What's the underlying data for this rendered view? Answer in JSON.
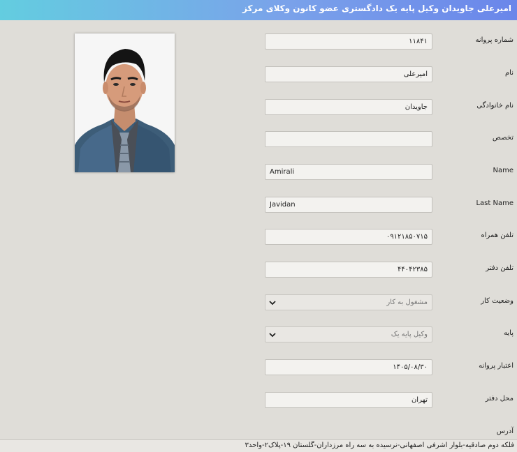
{
  "header": {
    "title": "امیرعلی جاویدان وکیل پایه یک دادگستری عضو کانون وکلای مرکز"
  },
  "profile_photo": {
    "alt": "عکس پرسنلی"
  },
  "fields": {
    "license_number": {
      "label": "شماره پروانه",
      "value": "۱۱۸۴۱"
    },
    "first_name": {
      "label": "نام",
      "value": "امیرعلی"
    },
    "last_name_fa": {
      "label": "نام خانوادگی",
      "value": "جاویدان"
    },
    "specialty": {
      "label": "تخصص",
      "value": ""
    },
    "name_en": {
      "label": "Name",
      "value": "Amirali"
    },
    "last_name_en": {
      "label": "Last Name",
      "value": "Javidan"
    },
    "mobile": {
      "label": "تلفن همراه",
      "value": "۰۹۱۲۱۸۵۰۷۱۵"
    },
    "office_phone": {
      "label": "تلفن دفتر",
      "value": "۴۴۰۴۲۳۸۵"
    },
    "work_status": {
      "label": "وضعیت کار",
      "value": "مشغول به کار"
    },
    "grade": {
      "label": "پایه",
      "value": "وکیل پایه یک"
    },
    "license_validity": {
      "label": "اعتبار پروانه",
      "value": "۱۴۰۵/۰۸/۳۰"
    },
    "office_location": {
      "label": "محل دفتر",
      "value": "تهران"
    },
    "address": {
      "label": "آدرس",
      "value": "فلکه دوم صادقیه-بلوار اشرفی اصفهانی-نرسیده به سه راه مرزداران-گلستان ۱۹-پلاک۲-واحد۳"
    }
  },
  "icons": {
    "dropdown": "chevron-down-icon"
  },
  "colors": {
    "background": "#dfddd8",
    "header_gradient_start": "#63cde0",
    "header_gradient_end": "#6a86ea",
    "field_bg": "#f3f2ef",
    "header_text": "#ffffff"
  }
}
